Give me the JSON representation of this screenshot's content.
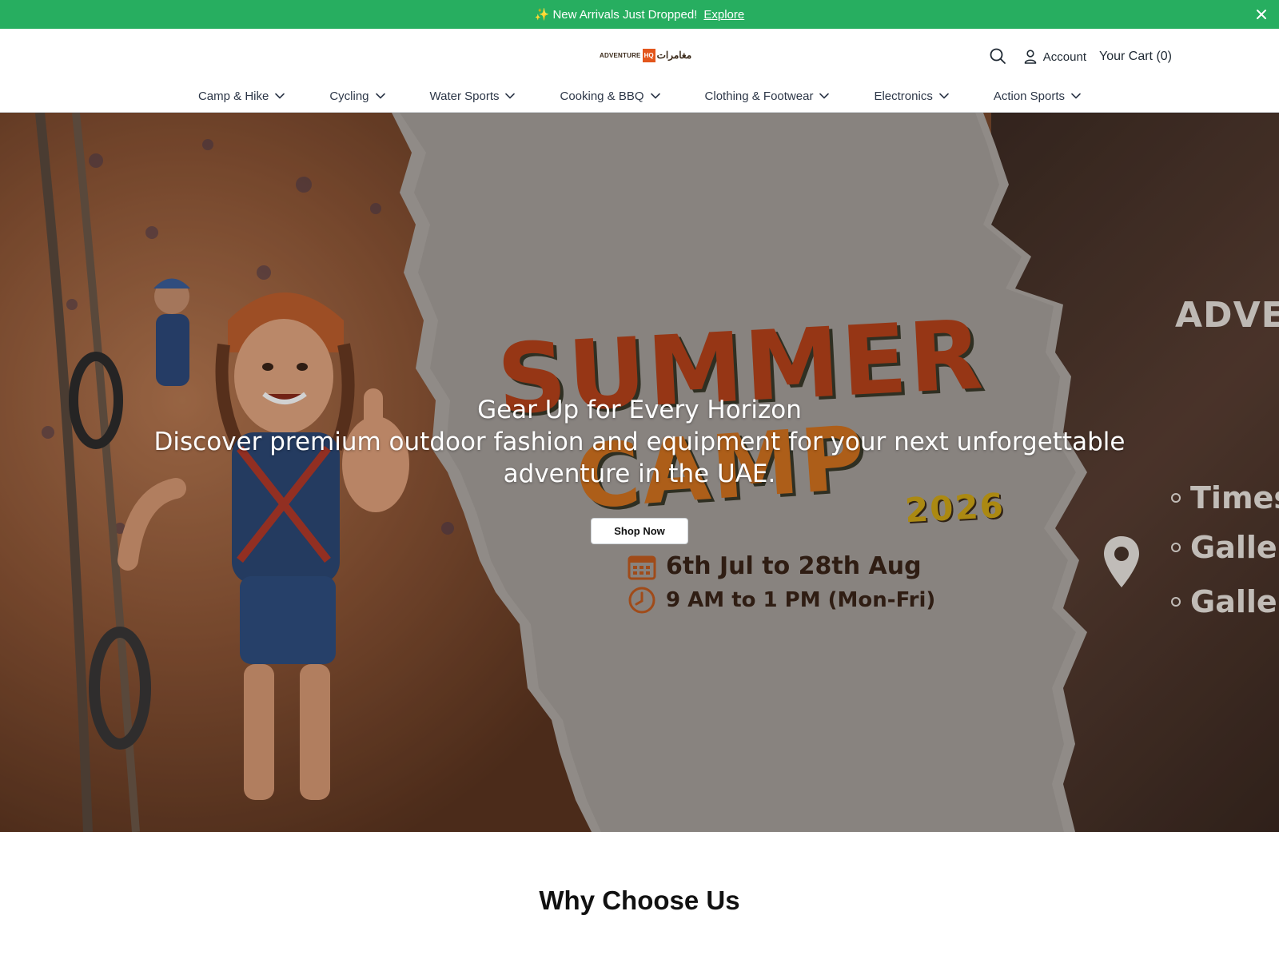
{
  "announcement": {
    "icon": "sparkles-icon",
    "sparkle": "✨",
    "text": "New Arrivals Just Dropped!",
    "link": "Explore"
  },
  "header": {
    "logo": {
      "en": "ADVENTURE",
      "hq": "HQ",
      "ar": "مغامرات"
    },
    "account_label": "Account",
    "cart_label": "Your Cart (0)"
  },
  "nav": {
    "items": [
      {
        "label": "Camp & Hike"
      },
      {
        "label": "Cycling"
      },
      {
        "label": "Water Sports"
      },
      {
        "label": "Cooking & BBQ"
      },
      {
        "label": "Clothing & Footwear"
      },
      {
        "label": "Electronics"
      },
      {
        "label": "Action Sports"
      }
    ]
  },
  "hero": {
    "banner": {
      "summer": "SUMMER",
      "camp": "CAMP",
      "year": "2026",
      "date": "6th Jul to 28th Aug",
      "time": "9 AM to 1 PM (Mon-Fri)",
      "side_title": "ADVEN",
      "locations": [
        "Times S",
        "Galleri",
        "Galleri"
      ]
    },
    "title": "Gear Up for Every Horizon",
    "subtitle": "Discover premium outdoor fashion and equipment for your next unforgettable adventure in the UAE.",
    "cta": "Shop Now"
  },
  "why": {
    "title": "Why Choose Us"
  },
  "colors": {
    "accent": "#27ae60",
    "camp_orange": "#c4541f",
    "year_gold": "#d1a817"
  }
}
